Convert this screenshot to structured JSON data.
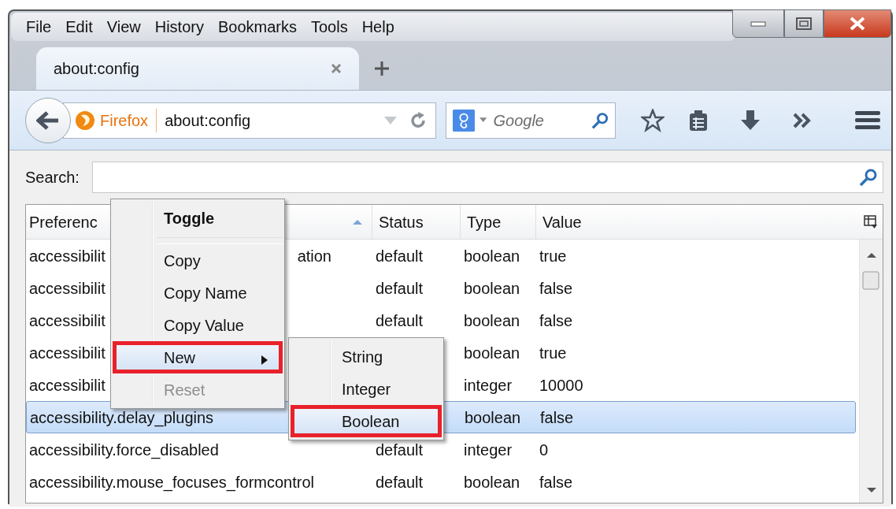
{
  "menu_bar": [
    "File",
    "Edit",
    "View",
    "History",
    "Bookmarks",
    "Tools",
    "Help"
  ],
  "tabs": [
    {
      "title": "about:config",
      "selected": true
    }
  ],
  "nav": {
    "identity": "Firefox",
    "url": "about:config",
    "search_placeholder": "Google"
  },
  "search": {
    "label": "Search:"
  },
  "table": {
    "columns": [
      "Preferenc",
      "Status",
      "Type",
      "Value"
    ],
    "rows": [
      {
        "name": "accessibilit",
        "name_tail": "ation",
        "status": "default",
        "type": "boolean",
        "value": "true",
        "selected": false
      },
      {
        "name": "accessibilit",
        "status": "default",
        "type": "boolean",
        "value": "false",
        "selected": false
      },
      {
        "name": "accessibilit",
        "status": "default",
        "type": "boolean",
        "value": "false",
        "selected": false
      },
      {
        "name": "accessibilit",
        "type": "boolean",
        "value": "true",
        "selected": false
      },
      {
        "name": "accessibilit",
        "type": "integer",
        "value": "10000",
        "selected": false
      },
      {
        "name": "accessibility.delay_plugins",
        "type": "boolean",
        "value": "false",
        "selected": true
      },
      {
        "name": "accessibility.force_disabled",
        "status": "default",
        "type": "integer",
        "value": "0",
        "selected": false
      },
      {
        "name": "accessibility.mouse_focuses_formcontrol",
        "status": "default",
        "type": "boolean",
        "value": "false",
        "selected": false
      }
    ]
  },
  "context_menu": {
    "items": [
      {
        "kind": "item",
        "label": "Toggle",
        "bold": true,
        "disabled": false,
        "submenu": false,
        "highlighted": false
      },
      {
        "kind": "separator"
      },
      {
        "kind": "item",
        "label": "Copy",
        "bold": false,
        "disabled": false,
        "submenu": false,
        "highlighted": false
      },
      {
        "kind": "item",
        "label": "Copy Name",
        "bold": false,
        "disabled": false,
        "submenu": false,
        "highlighted": false
      },
      {
        "kind": "item",
        "label": "Copy Value",
        "bold": false,
        "disabled": false,
        "submenu": false,
        "highlighted": false
      },
      {
        "kind": "item",
        "label": "New",
        "bold": false,
        "disabled": false,
        "submenu": true,
        "highlighted": true
      },
      {
        "kind": "item",
        "label": "Reset",
        "bold": false,
        "disabled": true,
        "submenu": false,
        "highlighted": false
      }
    ]
  },
  "submenu": {
    "items": [
      {
        "label": "String",
        "highlighted": false
      },
      {
        "label": "Integer",
        "highlighted": false
      },
      {
        "label": "Boolean",
        "highlighted": true
      }
    ]
  }
}
